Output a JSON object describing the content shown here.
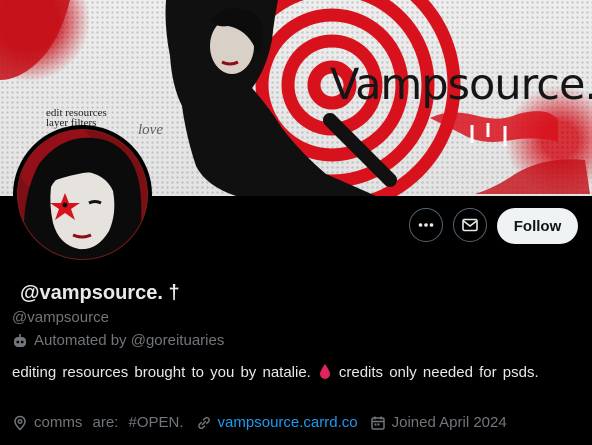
{
  "banner": {
    "brand_text": "Vampsource.",
    "edit_lines": [
      "edit resources",
      "layer filters"
    ],
    "love_text": "love"
  },
  "actions": {
    "more_icon": "more-icon",
    "message_icon": "envelope-icon",
    "follow_label": "Follow"
  },
  "profile": {
    "display_name": "@vampsource. †",
    "handle": "@vampsource",
    "automated_text": "Automated by @goreituaries",
    "bio_before": "editing resources brought to you by natalie.",
    "bio_after": "credits only needed for psds.",
    "location": "comms are: #OPEN.",
    "website": "vampsource.carrd.co",
    "joined": "Joined April 2024"
  },
  "colors": {
    "accent_link": "#1d9bf0",
    "muted": "#71767b",
    "banner_red": "#d8121c",
    "blood_drop": "#e0245e"
  }
}
